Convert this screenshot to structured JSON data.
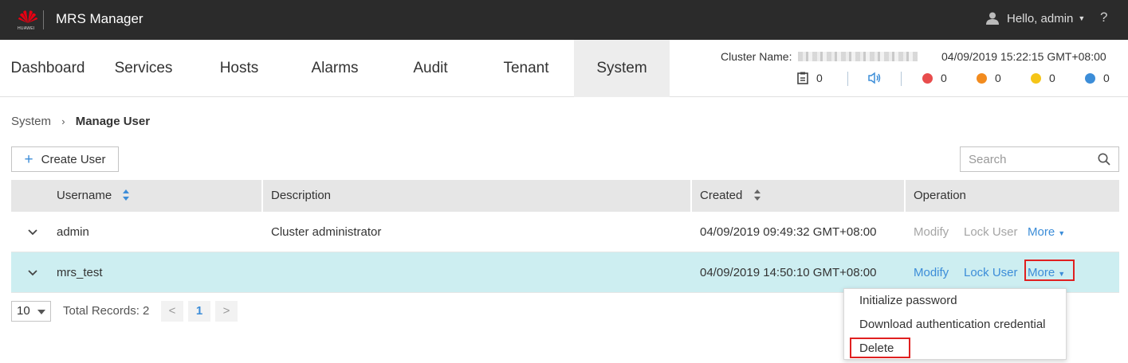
{
  "app": {
    "brand": "HUAWEI",
    "title": "MRS Manager"
  },
  "user_menu": {
    "label": "Hello, admin"
  },
  "help": {
    "label": "?"
  },
  "nav": {
    "tabs": [
      "Dashboard",
      "Services",
      "Hosts",
      "Alarms",
      "Audit",
      "Tenant",
      "System"
    ],
    "active": "System"
  },
  "cluster": {
    "name_label": "Cluster Name:",
    "datetime": "04/09/2019 15:22:15 GMT+08:00",
    "status": {
      "tasks": "0",
      "critical": "0",
      "major": "0",
      "minor": "0",
      "warning": "0"
    }
  },
  "breadcrumb": {
    "parent": "System",
    "separator": "›",
    "current": "Manage User"
  },
  "toolbar": {
    "create_label": "Create User",
    "search_placeholder": "Search"
  },
  "table": {
    "headers": {
      "username": "Username",
      "description": "Description",
      "created": "Created",
      "operation": "Operation"
    },
    "rows": [
      {
        "username": "admin",
        "description": "Cluster administrator",
        "created": "04/09/2019 09:49:32 GMT+08:00",
        "ops": {
          "modify": "Modify",
          "lock": "Lock User",
          "more": "More"
        }
      },
      {
        "username": "mrs_test",
        "description": "",
        "created": "04/09/2019 14:50:10 GMT+08:00",
        "ops": {
          "modify": "Modify",
          "lock": "Lock User",
          "more": "More"
        }
      }
    ]
  },
  "pagination": {
    "page_size": "10",
    "total": "Total Records: 2",
    "prev": "<",
    "current_page": "1",
    "next": ">"
  },
  "more_menu": {
    "items": [
      "Initialize password",
      "Download authentication credential",
      "Delete"
    ]
  },
  "colors": {
    "accent": "#3c8dd8",
    "critical": "#e84c4c",
    "major": "#f28b1e",
    "minor": "#f5c518",
    "warning": "#3c8dd8",
    "highlight": "#e02020",
    "selected_row": "#cdeef1"
  }
}
